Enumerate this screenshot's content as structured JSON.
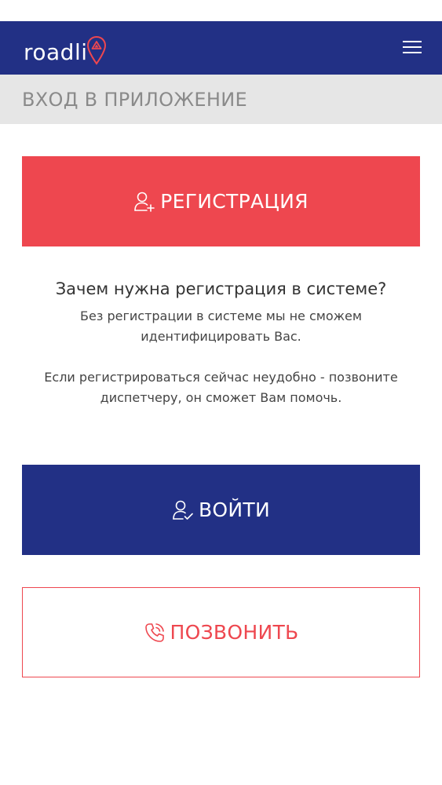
{
  "header": {
    "logo_text": "roadli",
    "menu_icon": "hamburger-menu-icon",
    "background_color": "#223085"
  },
  "page": {
    "title": "ВХОД В ПРИЛОЖЕНИЕ"
  },
  "register_button": {
    "label": "РЕГИСТРАЦИЯ",
    "icon": "user-add-icon",
    "color": "#ee474f"
  },
  "info": {
    "heading": "Зачем нужна регистрация в системе?",
    "text1_line1": "Без регистрации в системе мы не сможем",
    "text1_line2": "идентифицировать Вас.",
    "text2_line1": "Если регистрироваться сейчас неудобно - позвоните",
    "text2_line2": "диспетчеру, он сможет Вам помочь."
  },
  "login_button": {
    "label": "ВОЙТИ",
    "icon": "user-check-icon",
    "color": "#223085"
  },
  "call_button": {
    "label": "ПОЗВОНИТЬ",
    "icon": "phone-call-icon",
    "color": "#ee474f"
  }
}
